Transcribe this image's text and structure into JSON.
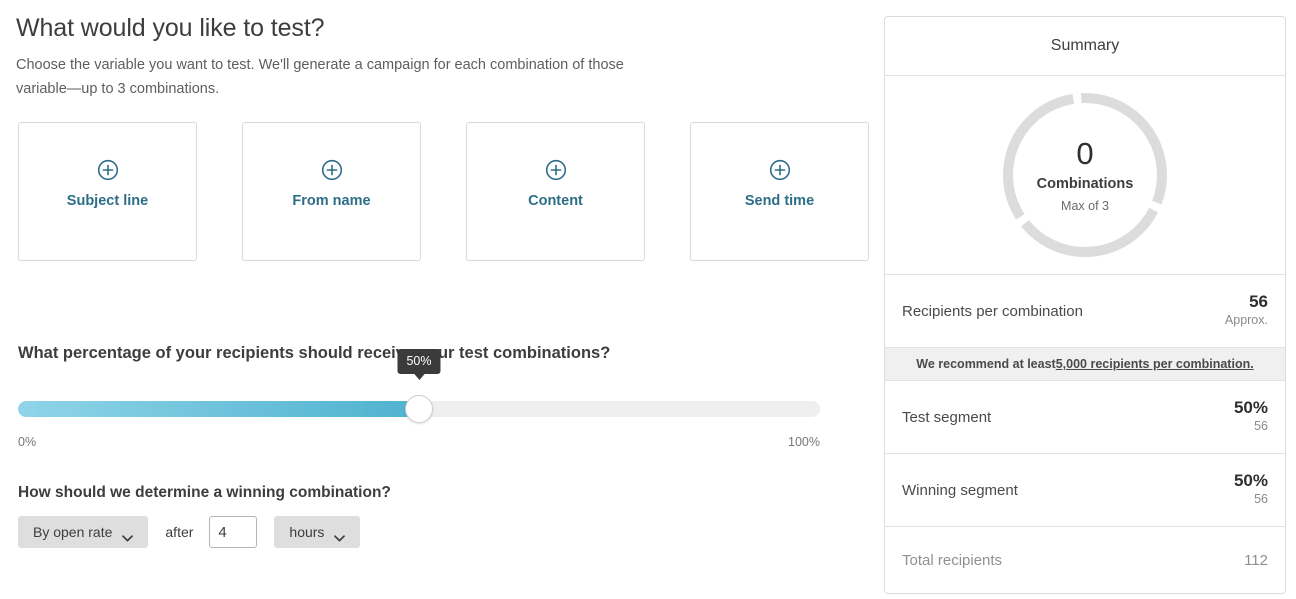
{
  "main": {
    "title": "What would you like to test?",
    "subtitle": "Choose the variable you want to test. We'll generate a campaign for each combination of those variable—up to 3 combinations.",
    "variables": [
      {
        "label": "Subject line",
        "icon": "plus-circle-icon"
      },
      {
        "label": "From name",
        "icon": "plus-circle-icon"
      },
      {
        "label": "Content",
        "icon": "plus-circle-icon"
      },
      {
        "label": "Send time",
        "icon": "plus-circle-icon"
      }
    ],
    "percentage_section": {
      "question": "What percentage of your recipients should receive your test combinations?",
      "tooltip_value": "50%",
      "slider_percent": 50,
      "min_label": "0%",
      "max_label": "100%"
    },
    "winner_section": {
      "question": "How should we determine a winning combination?",
      "metric_dropdown": "By open rate",
      "after_label": "after",
      "duration_value": "4",
      "unit_dropdown": "hours"
    }
  },
  "summary": {
    "header": "Summary",
    "donut": {
      "count": "0",
      "label": "Combinations",
      "sub": "Max of 3",
      "segments": 3,
      "filled": 0
    },
    "rows": [
      {
        "label": "Recipients per combination",
        "primary": "56",
        "secondary": "Approx."
      },
      {
        "label": "Test segment",
        "primary": "50%",
        "secondary": "56"
      },
      {
        "label": "Winning segment",
        "primary": "50%",
        "secondary": "56"
      }
    ],
    "recommendation": {
      "prefix": "We recommend at least ",
      "link": "5,000 recipients per combination."
    },
    "total": {
      "label": "Total recipients",
      "value": "112"
    }
  },
  "colors": {
    "accent_teal": "#2d6e87",
    "slider_start": "#90d4e8",
    "slider_end": "#4eb2cf",
    "tooltip_bg": "#3b3b3b",
    "ring_gray": "#dcdcdc"
  }
}
